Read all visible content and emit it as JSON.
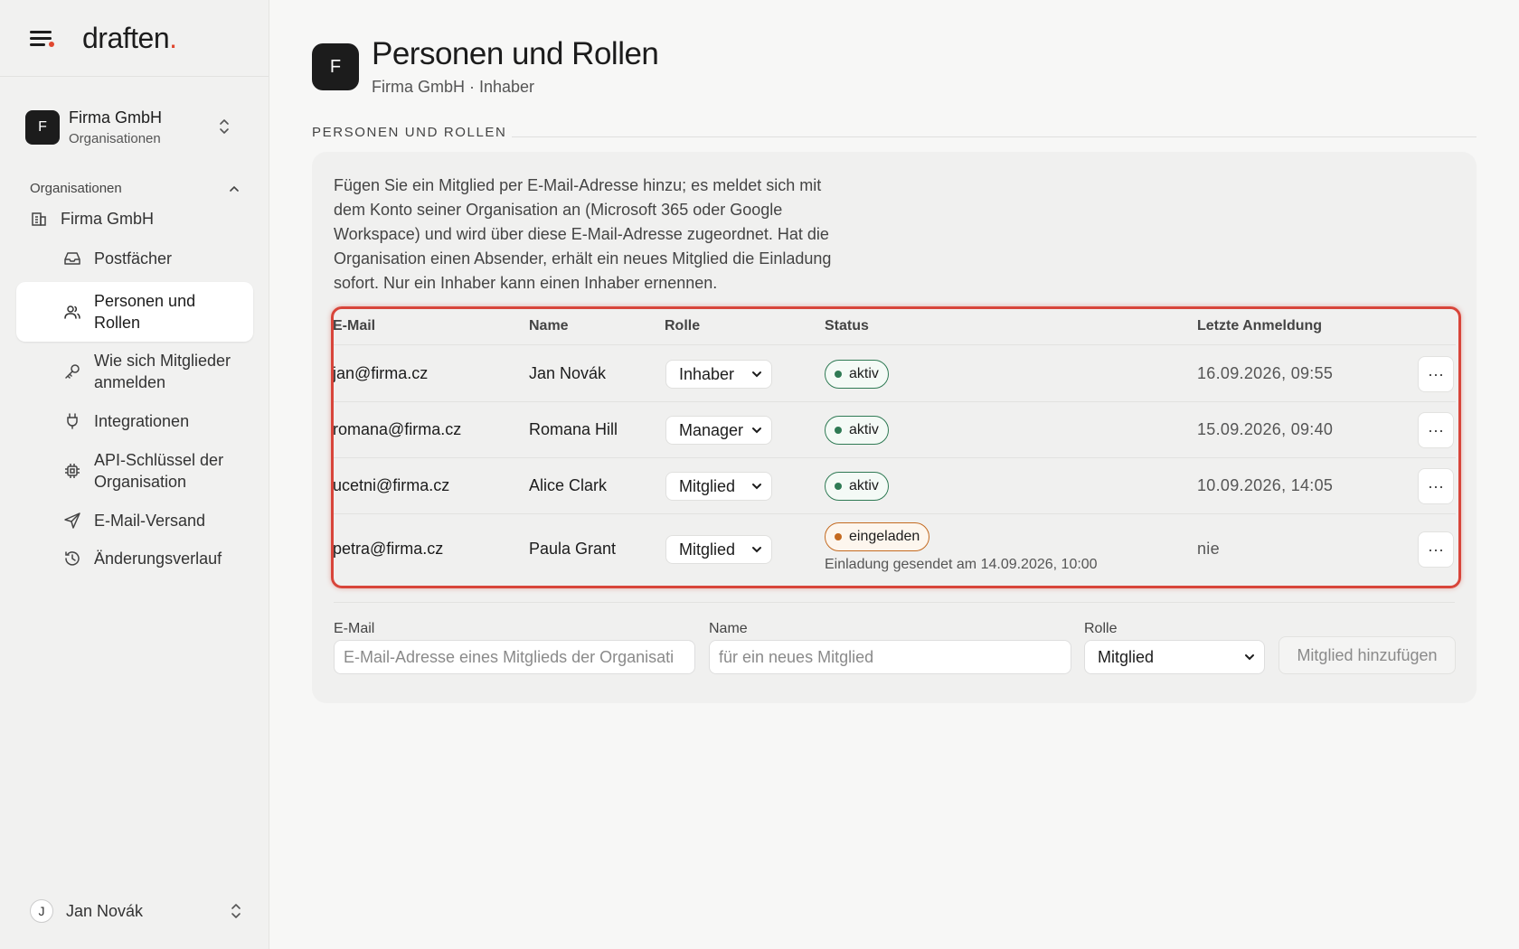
{
  "brand": {
    "logo_text": "draften",
    "logo_accent": ".",
    "accent_color": "#e0472f"
  },
  "org_switcher": {
    "avatar_letter": "F",
    "name": "Firma GmbH",
    "subtitle": "Organisationen"
  },
  "sidebar": {
    "section_label": "Organisationen",
    "org_item": "Firma GmbH",
    "items": [
      {
        "label": "Postfächer",
        "icon": "inbox-icon"
      },
      {
        "label_line1": "Personen und",
        "label_line2": "Rollen",
        "icon": "users-icon",
        "active": true
      },
      {
        "label_line1": "Wie sich Mitglieder",
        "label_line2": "anmelden",
        "icon": "key-icon"
      },
      {
        "label": "Integrationen",
        "icon": "plug-icon"
      },
      {
        "label_line1": "API-Schlüssel der",
        "label_line2": "Organisation",
        "icon": "chip-icon"
      },
      {
        "label": "E-Mail-Versand",
        "icon": "send-icon"
      },
      {
        "label": "Änderungsverlauf",
        "icon": "history-icon"
      }
    ]
  },
  "user": {
    "avatar_letter": "J",
    "name": "Jan Novák"
  },
  "header": {
    "avatar_letter": "F",
    "title": "Personen und Rollen",
    "subtitle": "Firma GmbH · Inhaber"
  },
  "section": {
    "label": "PERSONEN UND ROLLEN",
    "intro_lines": [
      "Fügen Sie ein Mitglied per E-Mail-Adresse hinzu; es meldet sich mit",
      "dem Konto seiner Organisation an (Microsoft 365 oder Google",
      "Workspace) und wird über diese E-Mail-Adresse zugeordnet. Hat die",
      "Organisation einen Absender, erhält ein neues Mitglied die Einladung",
      "sofort. Nur ein Inhaber kann einen Inhaber ernennen."
    ]
  },
  "table": {
    "columns": [
      "E-Mail",
      "Name",
      "Rolle",
      "Status",
      "Letzte Anmeldung"
    ],
    "rows": [
      {
        "email": "jan@firma.cz",
        "name": "Jan Novák",
        "role": "Inhaber",
        "status": "aktiv",
        "last_login": "16.09.2026, 09:55"
      },
      {
        "email": "romana@firma.cz",
        "name": "Romana Hill",
        "role": "Manager",
        "status": "aktiv",
        "last_login": "15.09.2026, 09:40"
      },
      {
        "email": "ucetni@firma.cz",
        "name": "Alice Clark",
        "role": "Mitglied",
        "status": "aktiv",
        "last_login": "10.09.2026, 14:05"
      },
      {
        "email": "petra@firma.cz",
        "name": "Paula Grant",
        "role": "Mitglied",
        "status": "eingeladen",
        "note": "Einladung gesendet am 14.09.2026, 10:00",
        "last_login": "nie"
      }
    ],
    "more_label": "···"
  },
  "add_form": {
    "email_label": "E-Mail",
    "email_placeholder": "E-Mail-Adresse eines Mitglieds der Organisati",
    "name_label": "Name",
    "name_placeholder": "für ein neues Mitglied",
    "role_label": "Rolle",
    "role_value": "Mitglied",
    "submit_label": "Mitglied hinzufügen"
  }
}
